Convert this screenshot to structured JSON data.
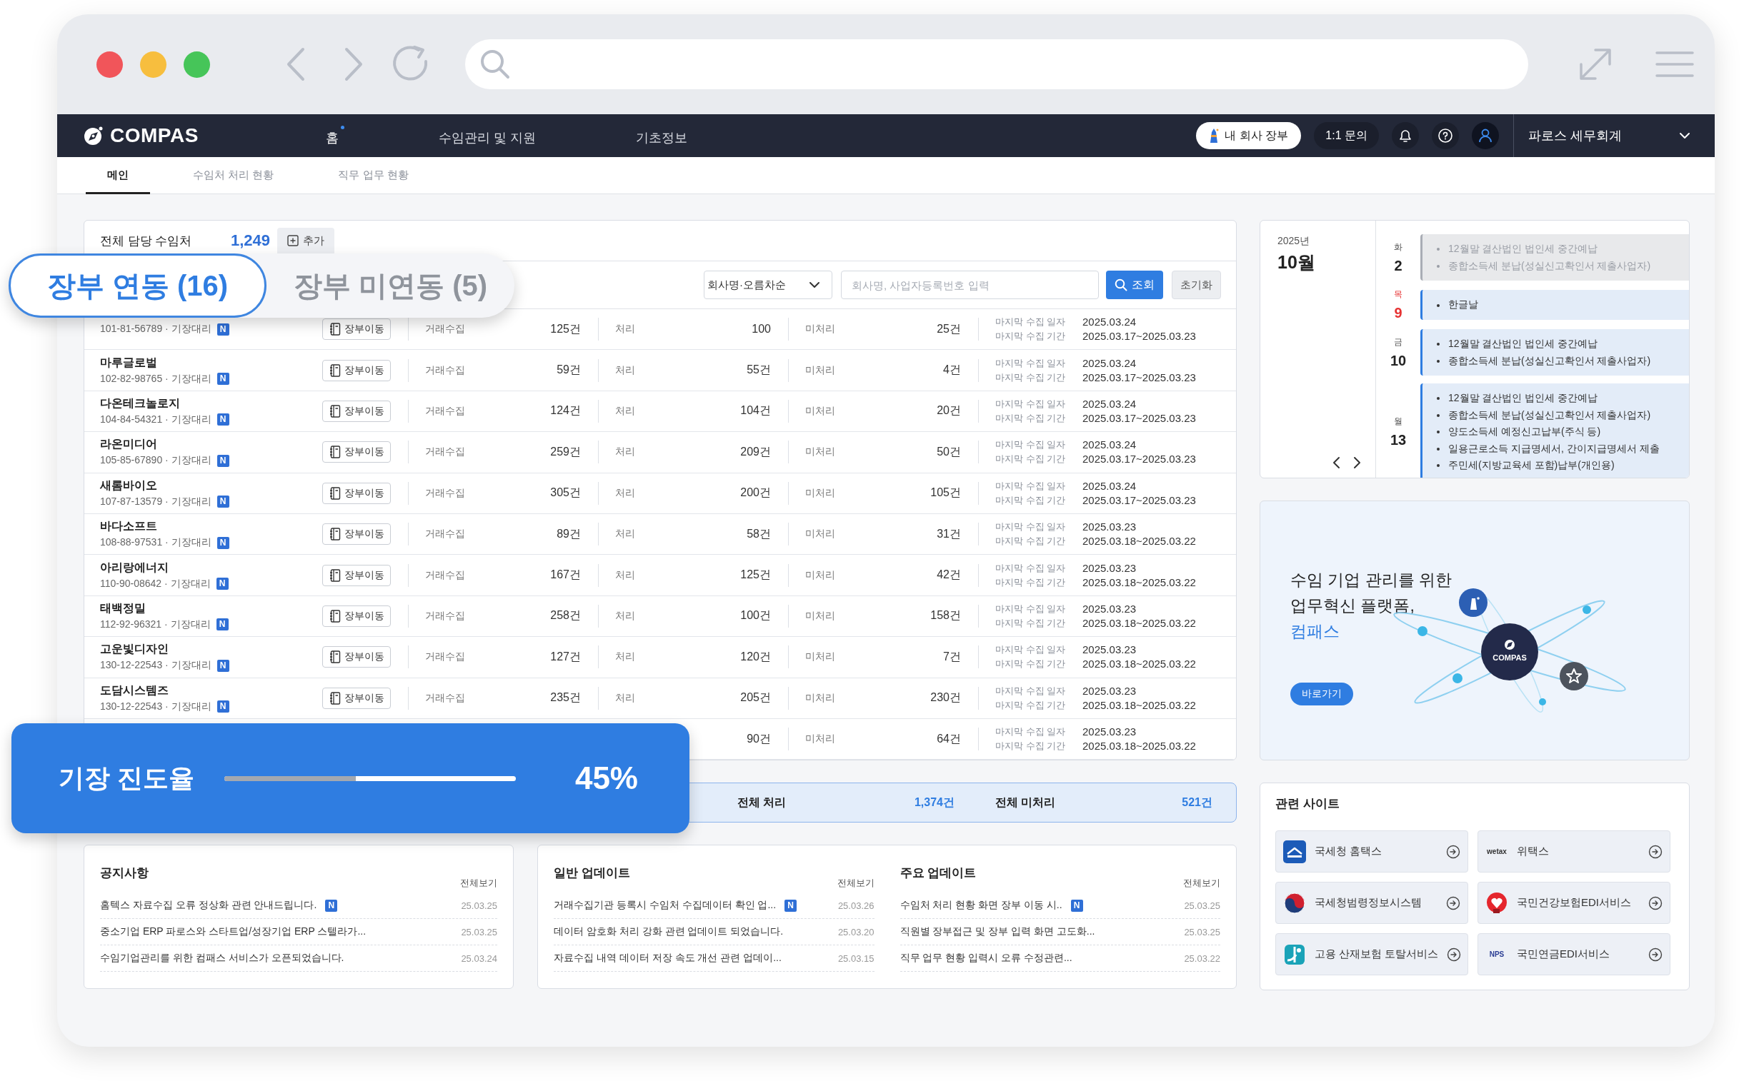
{
  "app": {
    "logo": "COMPAS",
    "nav": [
      {
        "label": "홈",
        "selected": true
      },
      {
        "label": "수임관리 및 지원",
        "selected": false
      },
      {
        "label": "기초정보",
        "selected": false
      }
    ],
    "my_books": "내 회사 장부",
    "inquiry": "1:1 문의",
    "company": "파로스 세무회계"
  },
  "tabs": [
    {
      "label": "메인",
      "selected": true
    },
    {
      "label": "수임처 처리 현황",
      "selected": false
    },
    {
      "label": "직무 업무 현황",
      "selected": false
    }
  ],
  "clients": {
    "title": "전체 담당 수임처",
    "count": "1,249",
    "add": "추가",
    "sort": "회사명·오름차순",
    "search": {
      "placeholder": "회사명, 사업자등록번호 입력"
    },
    "search_button": "조회",
    "reset_button": "초기화",
    "rows": [
      {
        "sub": "101-81-56789 · 기장대리",
        "badge": "N",
        "move": "장부이동",
        "collect": {
          "label": "거래수집",
          "value": "125건"
        },
        "done": {
          "label": "처리",
          "value": "100"
        },
        "pending": {
          "label": "미처리",
          "value": "25건"
        },
        "date_label": "마지막 수집 일자",
        "date": "2025.03.24",
        "period_label": "마지막 수집 기간",
        "period": "2025.03.17~2025.03.23"
      },
      {
        "name": "마루글로벌",
        "sub": "102-82-98765 · 기장대리",
        "badge": "N",
        "move": "장부이동",
        "collect": {
          "label": "거래수집",
          "value": "59건"
        },
        "done": {
          "label": "처리",
          "value": "55건"
        },
        "pending": {
          "label": "미처리",
          "value": "4건"
        },
        "date_label": "마지막 수집 일자",
        "date": "2025.03.24",
        "period_label": "마지막 수집 기간",
        "period": "2025.03.17~2025.03.23"
      },
      {
        "name": "다온테크놀로지",
        "sub": "104-84-54321 · 기장대리",
        "badge": "N",
        "move": "장부이동",
        "collect": {
          "label": "거래수집",
          "value": "124건"
        },
        "done": {
          "label": "처리",
          "value": "104건"
        },
        "pending": {
          "label": "미처리",
          "value": "20건"
        },
        "date_label": "마지막 수집 일자",
        "date": "2025.03.24",
        "period_label": "마지막 수집 기간",
        "period": "2025.03.17~2025.03.23"
      },
      {
        "name": "라온미디어",
        "sub": "105-85-67890 · 기장대리",
        "badge": "N",
        "move": "장부이동",
        "collect": {
          "label": "거래수집",
          "value": "259건"
        },
        "done": {
          "label": "처리",
          "value": "209건"
        },
        "pending": {
          "label": "미처리",
          "value": "50건"
        },
        "date_label": "마지막 수집 일자",
        "date": "2025.03.24",
        "period_label": "마지막 수집 기간",
        "period": "2025.03.17~2025.03.23"
      },
      {
        "name": "새롬바이오",
        "sub": "107-87-13579 · 기장대리",
        "badge": "N",
        "move": "장부이동",
        "collect": {
          "label": "거래수집",
          "value": "305건"
        },
        "done": {
          "label": "처리",
          "value": "200건"
        },
        "pending": {
          "label": "미처리",
          "value": "105건"
        },
        "date_label": "마지막 수집 일자",
        "date": "2025.03.24",
        "period_label": "마지막 수집 기간",
        "period": "2025.03.17~2025.03.23"
      },
      {
        "name": "바다소프트",
        "sub": "108-88-97531 · 기장대리",
        "badge": "N",
        "move": "장부이동",
        "collect": {
          "label": "거래수집",
          "value": "89건"
        },
        "done": {
          "label": "처리",
          "value": "58건"
        },
        "pending": {
          "label": "미처리",
          "value": "31건"
        },
        "date_label": "마지막 수집 일자",
        "date": "2025.03.23",
        "period_label": "마지막 수집 기간",
        "period": "2025.03.18~2025.03.22"
      },
      {
        "name": "아리랑에너지",
        "sub": "110-90-08642 · 기장대리",
        "badge": "N",
        "move": "장부이동",
        "collect": {
          "label": "거래수집",
          "value": "167건"
        },
        "done": {
          "label": "처리",
          "value": "125건"
        },
        "pending": {
          "label": "미처리",
          "value": "42건"
        },
        "date_label": "마지막 수집 일자",
        "date": "2025.03.23",
        "period_label": "마지막 수집 기간",
        "period": "2025.03.18~2025.03.22"
      },
      {
        "name": "태백정밀",
        "sub": "112-92-96321 · 기장대리",
        "badge": "N",
        "move": "장부이동",
        "collect": {
          "label": "거래수집",
          "value": "258건"
        },
        "done": {
          "label": "처리",
          "value": "100건"
        },
        "pending": {
          "label": "미처리",
          "value": "158건"
        },
        "date_label": "마지막 수집 일자",
        "date": "2025.03.23",
        "period_label": "마지막 수집 기간",
        "period": "2025.03.18~2025.03.22"
      },
      {
        "name": "고운빛디자인",
        "sub": "130-12-22543 · 기장대리",
        "badge": "N",
        "move": "장부이동",
        "collect": {
          "label": "거래수집",
          "value": "127건"
        },
        "done": {
          "label": "처리",
          "value": "120건"
        },
        "pending": {
          "label": "미처리",
          "value": "7건"
        },
        "date_label": "마지막 수집 일자",
        "date": "2025.03.23",
        "period_label": "마지막 수집 기간",
        "period": "2025.03.18~2025.03.22"
      },
      {
        "name": "도담시스템즈",
        "sub": "130-12-22543 · 기장대리",
        "badge": "N",
        "move": "장부이동",
        "collect": {
          "label": "거래수집",
          "value": "235건"
        },
        "done": {
          "label": "처리",
          "value": "205건"
        },
        "pending": {
          "label": "미처리",
          "value": "230건"
        },
        "date_label": "마지막 수집 일자",
        "date": "2025.03.23",
        "period_label": "마지막 수집 기간",
        "period": "2025.03.18~2025.03.22"
      },
      {
        "done": {
          "value": "90건"
        },
        "pending": {
          "label": "미처리",
          "value": "64건"
        },
        "date_label": "마지막 수집 일자",
        "date": "2025.03.23",
        "period_label": "마지막 수집 기간",
        "period": "2025.03.18~2025.03.22"
      }
    ]
  },
  "summary": [
    {
      "label": "전체 처리",
      "value": "1,374건"
    },
    {
      "label": "전체 미처리",
      "value": "521건"
    }
  ],
  "sync_tabs": [
    {
      "label": "장부 연동 (16)",
      "selected": true
    },
    {
      "label": "장부 미연동 (5)",
      "selected": false
    }
  ],
  "progress": {
    "title": "기장 진도율",
    "level": 0.45,
    "reading": "45%"
  },
  "notices": {
    "title": "공지사항",
    "more": "전체보기",
    "items": [
      {
        "text": "홈텍스 자료수집 오류 정상화 관련 안내드립니다.",
        "badge": "N",
        "date": "25.03.25"
      },
      {
        "text": "중소기업 ERP 파로스와  스타트업/성장기업 ERP 스텔라가...",
        "date": "25.03.25"
      },
      {
        "text": "수임기업관리를 위한 컴패스 서비스가 오픈되었습니다.",
        "date": "25.03.24"
      }
    ]
  },
  "updates": [
    {
      "title": "일반 업데이트",
      "more": "전체보기",
      "items": [
        {
          "text": "거래수집기관  등록시 수임처  수집데이터 확인 업...",
          "badge": "N",
          "date": "25.03.26"
        },
        {
          "text": "데이터 암호화 처리 강화 관련 업데이트 되었습니다.",
          "date": "25.03.20"
        },
        {
          "text": "자료수집 내역 데이터 저장 속도 개선 관련 업데이...",
          "date": "25.03.15"
        }
      ]
    },
    {
      "title": "주요 업데이트",
      "more": "전체보기",
      "items": [
        {
          "text": "수임처 처리 현황 화면 장부 이동 시..",
          "badge": "N",
          "date": "25.03.25"
        },
        {
          "text": "직원별 장부접근 및 장부 입력 화면 고도화...",
          "date": "25.03.25"
        },
        {
          "text": "직무 업무 현황 입력시 오류 수정관련...",
          "date": "25.03.22"
        }
      ]
    }
  ],
  "calendar": {
    "year": "2025년",
    "month": "10월",
    "days": [
      {
        "weekday": "화",
        "day": "2",
        "past": true,
        "holiday": false,
        "events": [
          "12월말 결산법인 법인세 중간예납",
          "종합소득세 분납(성실신고확인서 제출사업자)"
        ]
      },
      {
        "weekday": "목",
        "day": "9",
        "past": false,
        "holiday": true,
        "events": [
          "한글날"
        ]
      },
      {
        "weekday": "금",
        "day": "10",
        "past": false,
        "holiday": false,
        "events": [
          "12월말 결산법인 법인세 중간예납",
          "종합소득세 분납(성실신고확인서 제출사업자)"
        ]
      },
      {
        "weekday": "월",
        "day": "13",
        "past": false,
        "holiday": false,
        "events": [
          "12월말 결산법인 법인세 중간예납",
          "종합소득세 분납(성실신고확인서 제출사업자)",
          "양도소득세 예정신고납부(주식 등)",
          "일용근로소득 지급명세서, 간이지급명세서 제출",
          "주민세(지방교육세 포함)납부(개인용)"
        ]
      }
    ]
  },
  "banner": {
    "lines": [
      "수임 기업 관리를 위한",
      "업무혁신 플랫폼,"
    ],
    "highlight": "컴패스",
    "button": "바로가기",
    "logo": "COMPAS"
  },
  "sites": {
    "title": "관련 사이트",
    "items": [
      {
        "name": "국세청 홈택스",
        "kind": "hometax"
      },
      {
        "name": "위택스",
        "kind": "wetax",
        "logo_text": "wetax"
      },
      {
        "name": "국세청범령정보시스템",
        "kind": "taegeuk"
      },
      {
        "name": "국민건강보험EDI서비스",
        "kind": "heart"
      },
      {
        "name": "고용 산재보험 토탈서비스",
        "kind": "employ"
      },
      {
        "name": "국민연금EDI서비스",
        "kind": "nps",
        "logo_text": "NPS"
      }
    ]
  }
}
